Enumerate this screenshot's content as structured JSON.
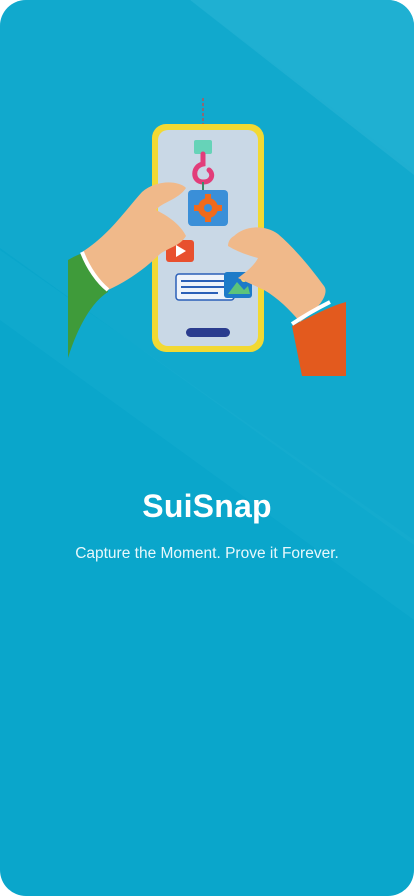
{
  "app": {
    "title": "SuiSnap",
    "tagline": "Capture the Moment. Prove it Forever."
  },
  "colors": {
    "background": "#0aa6cb",
    "band": "#22b3d4",
    "title_text": "#ffffff"
  },
  "icons": {
    "hero": "hands-holding-phone-illustration",
    "gear": "gear-icon",
    "play": "play-icon",
    "image": "image-icon",
    "hook": "crane-hook-icon"
  }
}
